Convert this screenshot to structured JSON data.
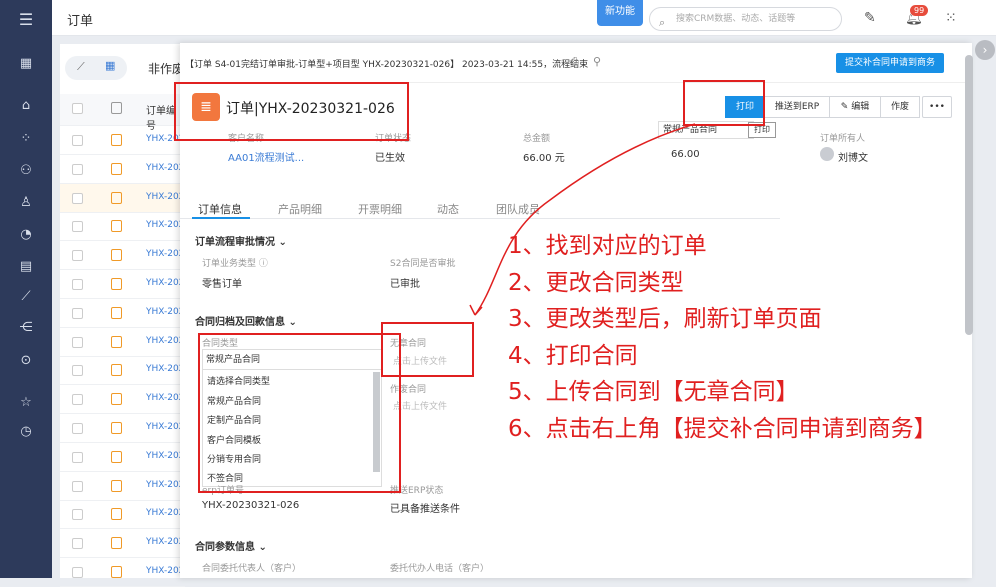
{
  "topbar": {
    "title": "订单",
    "new_feature": "新功能",
    "search_placeholder": "搜索CRM数据、动态、话题等",
    "notification_count": "99"
  },
  "nav_icons": [
    "menu-icon",
    "grid-icon",
    "home-icon",
    "apps-icon",
    "users-icon",
    "contact-icon",
    "pie-icon",
    "report-icon",
    "chart-icon",
    "flow-icon",
    "target-icon",
    "star-icon",
    "clock-icon"
  ],
  "list": {
    "tab_label": "非作废",
    "col_header": "订单编号",
    "rows": [
      "YHX-202",
      "YHX-202",
      "YHX-202",
      "YHX-202",
      "YHX-202",
      "YHX-202",
      "YHX-202",
      "YHX-202",
      "YHX-202",
      "YHX-202",
      "YHX-202",
      "YHX-202",
      "YHX-202",
      "YHX-202",
      "YHX-202",
      "YHX-202"
    ]
  },
  "drawer": {
    "header_text": "【订单 S4-01完结订单审批-订单型+项目型 YHX-20230321-026】 2023-03-21 14:55，流程结束",
    "submit_button": "提交补合同申请到商务",
    "order_title": "订单|YHX-20230321-026",
    "actions": {
      "print": "打印",
      "push_erp": "推送到ERP",
      "edit": "编辑",
      "void": "作废",
      "more": "•••"
    },
    "summary": {
      "customer_label": "客户名称",
      "customer_value": "AA01流程测试...",
      "status_label": "订单状态",
      "status_value": "已生效",
      "amount_label": "总金额",
      "amount_value": "66.00 元",
      "contract_select": "常规产品合同",
      "print_small": "打印",
      "contract_amount_value": "66.00",
      "owner_label": "订单所有人",
      "owner_value": "刘博文"
    },
    "tabs": [
      "订单信息",
      "产品明细",
      "开票明细",
      "动态",
      "团队成员"
    ],
    "section1": {
      "title": "订单流程审批情况",
      "business_type_label": "订单业务类型",
      "business_type_value": "零售订单",
      "s2_label": "S2合同是否审批",
      "s2_value": "已审批"
    },
    "section2": {
      "title": "合同归档及回款信息",
      "contract_type_label": "合同类型",
      "contract_type_value": "常规产品合同",
      "options": [
        "请选择合同类型",
        "常规产品合同",
        "定制产品合同",
        "客户合同模板",
        "分销专用合同",
        "不签合同"
      ],
      "no_seal_label": "无章合同",
      "upload1": "点击上传文件",
      "void_contract_label": "作废合同",
      "upload2": "点击上传文件",
      "erp_no_label": "erp订单号",
      "erp_no_value": "YHX-20230321-026",
      "push_status_label": "推送ERP状态",
      "push_status_value": "已具备推送条件"
    },
    "section3": {
      "title": "合同参数信息",
      "field1": "合同委托代表人（客户）",
      "field2": "委托代办人电话（客户）"
    }
  },
  "steps": [
    "1、找到对应的订单",
    "2、更改合同类型",
    "3、更改类型后，刷新订单页面",
    "4、打印合同",
    "5、上传合同到【无章合同】",
    "6、点击右上角【提交补合同申请到商务】"
  ],
  "colors": {
    "annotation": "#e02020",
    "primary": "#1890e6",
    "nav": "#2d3a5b"
  }
}
